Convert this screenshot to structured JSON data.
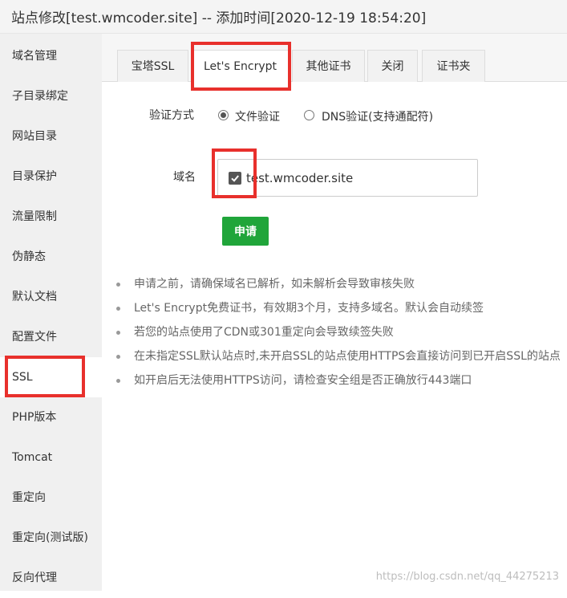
{
  "title": "站点修改[test.wmcoder.site] -- 添加时间[2020-12-19 18:54:20]",
  "sidebar": {
    "items": [
      {
        "label": "域名管理"
      },
      {
        "label": "子目录绑定"
      },
      {
        "label": "网站目录"
      },
      {
        "label": "目录保护"
      },
      {
        "label": "流量限制"
      },
      {
        "label": "伪静态"
      },
      {
        "label": "默认文档"
      },
      {
        "label": "配置文件"
      },
      {
        "label": "SSL"
      },
      {
        "label": "PHP版本"
      },
      {
        "label": "Tomcat"
      },
      {
        "label": "重定向"
      },
      {
        "label": "重定向(测试版)"
      },
      {
        "label": "反向代理"
      }
    ],
    "active": "SSL"
  },
  "tabs": [
    {
      "label": "宝塔SSL"
    },
    {
      "label": "Let's Encrypt"
    },
    {
      "label": "其他证书"
    },
    {
      "label": "关闭"
    },
    {
      "label": "证书夹"
    }
  ],
  "active_tab": "Let's Encrypt",
  "form": {
    "verify_label": "验证方式",
    "options": [
      {
        "label": "文件验证",
        "checked": true
      },
      {
        "label": "DNS验证(支持通配符)",
        "checked": false
      }
    ],
    "domain_label": "域名",
    "domain_value": "test.wmcoder.site",
    "domain_checked": true,
    "apply_label": "申请"
  },
  "notes": [
    "申请之前，请确保域名已解析，如未解析会导致审核失败",
    "Let's Encrypt免费证书，有效期3个月，支持多域名。默认会自动续签",
    "若您的站点使用了CDN或301重定向会导致续签失败",
    "在未指定SSL默认站点时,未开启SSL的站点使用HTTPS会直接访问到已开启SSL的站点",
    "如开启后无法使用HTTPS访问，请检查安全组是否正确放行443端口"
  ],
  "watermark": "https://blog.csdn.net/qq_44275213",
  "colors": {
    "primary_button": "#20a53a",
    "highlight_box": "#e8302c",
    "sidebar_bg": "#f0f0f0"
  }
}
